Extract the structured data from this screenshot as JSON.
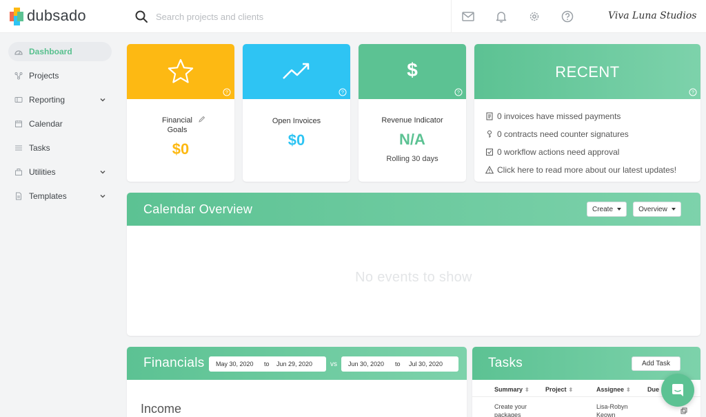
{
  "app": {
    "logo_text": "dubsado",
    "studio_name": "Viva Luna Studios"
  },
  "search": {
    "placeholder": "Search projects and clients"
  },
  "header_icons": [
    "mail-icon",
    "bell-icon",
    "gear-icon",
    "help-icon"
  ],
  "sidebar": {
    "items": [
      {
        "label": "Dashboard",
        "icon": "dashboard-icon",
        "active": true,
        "has_children": false
      },
      {
        "label": "Projects",
        "icon": "projects-icon",
        "active": false,
        "has_children": false
      },
      {
        "label": "Reporting",
        "icon": "reporting-icon",
        "active": false,
        "has_children": true
      },
      {
        "label": "Calendar",
        "icon": "calendar-icon",
        "active": false,
        "has_children": false
      },
      {
        "label": "Tasks",
        "icon": "tasks-icon",
        "active": false,
        "has_children": false
      },
      {
        "label": "Utilities",
        "icon": "utilities-icon",
        "active": false,
        "has_children": true
      },
      {
        "label": "Templates",
        "icon": "templates-icon",
        "active": false,
        "has_children": true
      }
    ]
  },
  "cards": {
    "financial_goals": {
      "label": "Financial Goals",
      "value": "$0",
      "color": "#fdb913",
      "icon": "star-icon"
    },
    "open_invoices": {
      "label": "Open Invoices",
      "value": "$0",
      "color": "#2ec4f3",
      "icon": "trend-up-icon"
    },
    "revenue": {
      "label": "Revenue Indicator",
      "value": "N/A",
      "sub": "Rolling 30 days",
      "color": "#5cc293",
      "icon": "dollar-icon"
    }
  },
  "recent": {
    "title": "RECENT",
    "items": [
      {
        "icon": "invoice-icon",
        "text": "0 invoices have missed payments"
      },
      {
        "icon": "pen-icon",
        "text": "0 contracts need counter signatures"
      },
      {
        "icon": "checkbox-icon",
        "text": "0 workflow actions need approval"
      },
      {
        "icon": "warning-icon",
        "text": "Click here to read more about our latest updates!"
      }
    ]
  },
  "calendar": {
    "title": "Calendar Overview",
    "create_label": "Create",
    "overview_label": "Overview",
    "empty_text": "No events to show"
  },
  "financials": {
    "title": "Financials",
    "range1": {
      "from": "May 30, 2020",
      "to_label": "to",
      "to": "Jun 29, 2020"
    },
    "vs_label": "vs",
    "range2": {
      "from": "Jun 30, 2020",
      "to_label": "to",
      "to": "Jul 30, 2020"
    },
    "income_label": "Income"
  },
  "tasks": {
    "title": "Tasks",
    "add_label": "Add Task",
    "columns": [
      "Summary",
      "Project",
      "Assignee",
      "Due"
    ],
    "rows": [
      {
        "summary": "Create your packages",
        "project": "",
        "assignee": "Lisa-Robyn Keown",
        "due": ""
      }
    ]
  },
  "colors": {
    "accent_green": "#5cc293",
    "yellow": "#fdb913",
    "blue": "#2ec4f3"
  }
}
